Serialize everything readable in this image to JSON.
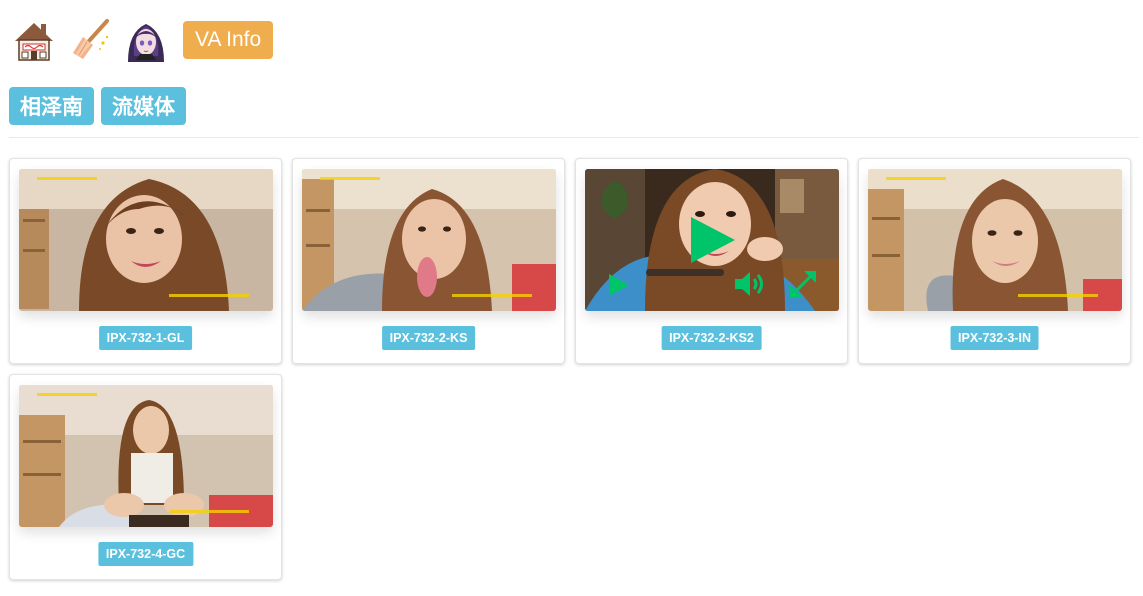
{
  "header": {
    "buttons": [
      {
        "name": "home-icon"
      },
      {
        "name": "broom-icon"
      },
      {
        "name": "avatar"
      }
    ],
    "va_info_label": "VA Info"
  },
  "tags": [
    {
      "label": "相泽南"
    },
    {
      "label": "流媒体"
    }
  ],
  "videos": [
    {
      "label": "IPX-732-1-GL",
      "playing": false
    },
    {
      "label": "IPX-732-2-KS",
      "playing": false
    },
    {
      "label": "IPX-732-2-KS2",
      "playing": true
    },
    {
      "label": "IPX-732-3-IN",
      "playing": false
    },
    {
      "label": "IPX-732-4-GC",
      "playing": false
    }
  ],
  "colors": {
    "tag": "#5bc0de",
    "va_info": "#f0ad4e",
    "player_controls": "#00c46a"
  }
}
